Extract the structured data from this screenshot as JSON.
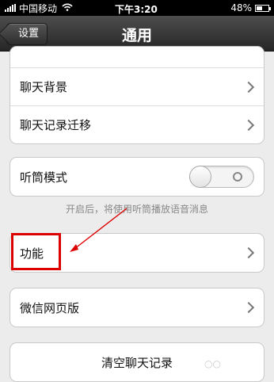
{
  "status_bar": {
    "carrier": "中国移动",
    "time": "下午3:20",
    "battery": "48%",
    "battery_level": 0.48,
    "signal_icon": "signal-icon",
    "wifi_icon": "wifi-icon",
    "battery_icon": "battery-icon"
  },
  "nav": {
    "back_label": "设置",
    "title": "通用"
  },
  "group1": {
    "items": [
      {
        "label": "聊天背景"
      },
      {
        "label": "聊天记录迁移"
      }
    ]
  },
  "group2": {
    "label": "听筒模式",
    "toggle_state": "off",
    "hint": "开启后，将使用听筒播放语音消息"
  },
  "group3": {
    "label": "功能"
  },
  "group4": {
    "label": "微信网页版"
  },
  "group5": {
    "label": "清空聊天记录"
  },
  "annotation": {
    "color": "#d00000"
  }
}
